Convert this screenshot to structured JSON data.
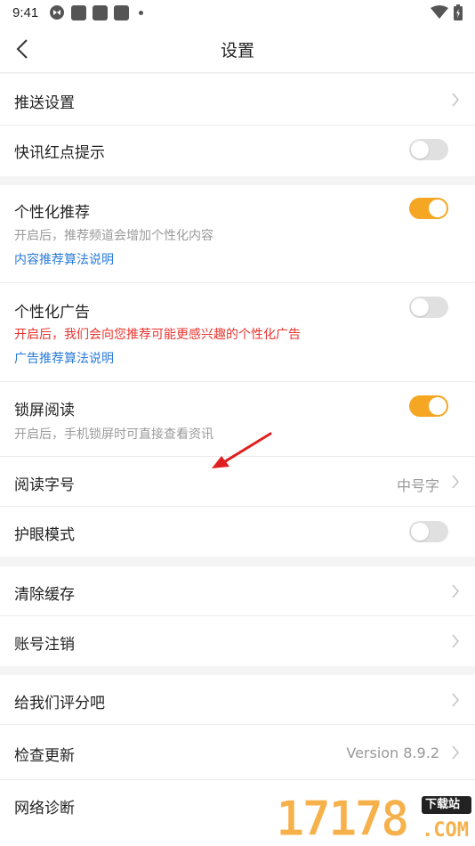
{
  "status": {
    "time": "9:41"
  },
  "nav": {
    "title": "设置"
  },
  "rows": {
    "push": {
      "label": "推送设置"
    },
    "news_dot": {
      "label": "快讯红点提示",
      "on": false
    },
    "personal_rec": {
      "label": "个性化推荐",
      "desc": "开启后，推荐频道会增加个性化内容",
      "link": "内容推荐算法说明",
      "on": true
    },
    "personal_ad": {
      "label": "个性化广告",
      "desc": "开启后，我们会向您推荐可能更感兴趣的个性化广告",
      "link": "广告推荐算法说明",
      "on": false
    },
    "lock_read": {
      "label": "锁屏阅读",
      "desc": "开启后，手机锁屏时可直接查看资讯",
      "on": true
    },
    "font_size": {
      "label": "阅读字号",
      "value": "中号字"
    },
    "eye": {
      "label": "护眼模式",
      "on": false
    },
    "clear_cache": {
      "label": "清除缓存"
    },
    "cancel_account": {
      "label": "账号注销"
    },
    "rate": {
      "label": "给我们评分吧"
    },
    "update": {
      "label": "检查更新",
      "value": "Version 8.9.2"
    },
    "diagnose": {
      "label": "网络诊断"
    }
  },
  "watermark": {
    "digits": "17178",
    "tag": "下载站",
    "com": ".COM"
  },
  "colors": {
    "toggle_on": "#f5a623",
    "toggle_off": "#e0e0e0",
    "link": "#2a7bd8",
    "warning": "#e8352f"
  }
}
